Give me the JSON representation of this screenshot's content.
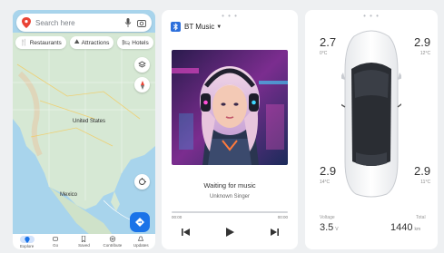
{
  "map": {
    "search_placeholder": "Search here",
    "chips": [
      {
        "icon": "fork-knife-icon",
        "glyph": "🍴",
        "label": "Restaurants"
      },
      {
        "icon": "attractions-icon",
        "glyph": "⛰",
        "label": "Attractions"
      },
      {
        "icon": "hotel-icon",
        "glyph": "🛏",
        "label": "Hotels"
      }
    ],
    "labels": {
      "country": "United States",
      "mexico": "Mexico"
    },
    "nav": [
      {
        "label": "Explore",
        "icon": "explore-icon",
        "active": true
      },
      {
        "label": "Go",
        "icon": "go-icon",
        "active": false
      },
      {
        "label": "Saved",
        "icon": "saved-icon",
        "active": false
      },
      {
        "label": "Contribute",
        "icon": "contribute-icon",
        "active": false
      },
      {
        "label": "Updates",
        "icon": "updates-icon",
        "active": false
      }
    ],
    "colors": {
      "accent": "#1a73e8",
      "water": "#a8d4ec",
      "land": "#d6e8d4"
    }
  },
  "music": {
    "source": "BT Music",
    "title": "Waiting for music",
    "artist": "Unknown Singer",
    "elapsed": "00:00",
    "total": "00:00",
    "progress": 0,
    "controls": [
      "previous",
      "play",
      "next"
    ]
  },
  "vehicle": {
    "tires": {
      "front_left": {
        "pressure": "2.7",
        "temp": "0°C"
      },
      "front_right": {
        "pressure": "2.9",
        "temp": "12°C"
      },
      "rear_left": {
        "pressure": "2.9",
        "temp": "14°C"
      },
      "rear_right": {
        "pressure": "2.9",
        "temp": "11°C"
      }
    },
    "voltage": {
      "label": "Voltage",
      "value": "3.5",
      "unit": "V"
    },
    "range": {
      "label": "Total",
      "value": "1440",
      "unit": "km"
    }
  }
}
